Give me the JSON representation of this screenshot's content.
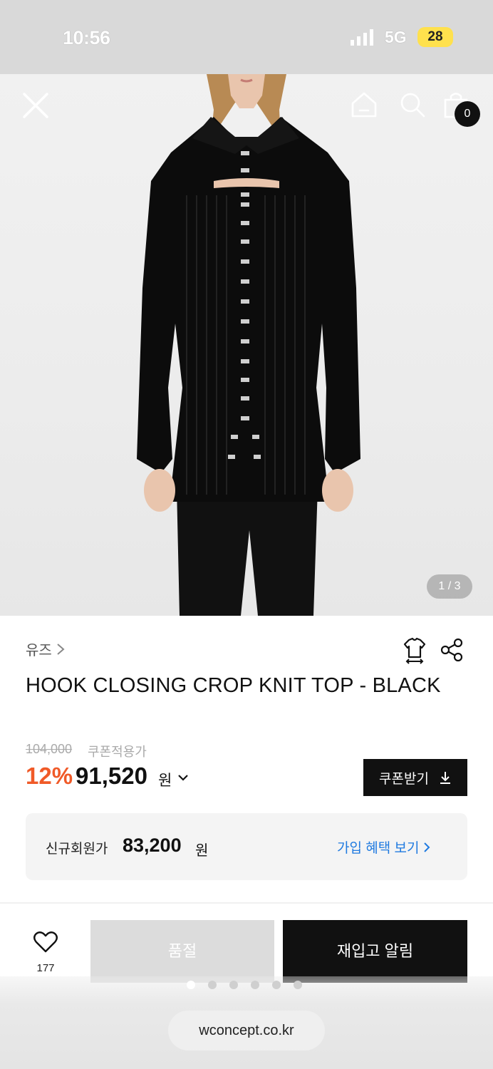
{
  "status_bar": {
    "time": "10:56",
    "network": "5G",
    "battery": "28"
  },
  "header": {
    "cart_count": "0",
    "icons": [
      "close-icon",
      "home-icon",
      "search-icon",
      "shopping-bag-icon"
    ]
  },
  "gallery": {
    "counter": "1 / 3",
    "current_index": 1,
    "total": 3
  },
  "product": {
    "brand": "유즈",
    "title": "HOOK CLOSING CROP KNIT TOP - BLACK",
    "original_price": "104,000",
    "coupon_price_label": "쿠폰적용가",
    "discount": "12%",
    "sale_price": "91,520",
    "currency": "원",
    "coupon_button": "쿠폰받기"
  },
  "member": {
    "label": "신규회원가",
    "price": "83,200",
    "currency": "원",
    "benefit_link": "가입 혜택 보기"
  },
  "actions": {
    "like_count": "177",
    "soldout_label": "품절",
    "restock_label": "재입고 알림"
  },
  "browser": {
    "url": "wconcept.co.kr",
    "page_dots": 6,
    "active_dot": 0
  },
  "colors": {
    "discount": "#f05a28",
    "link": "#1f7ae0",
    "primary_button": "#111111",
    "disabled_button": "#dcdcdc"
  }
}
